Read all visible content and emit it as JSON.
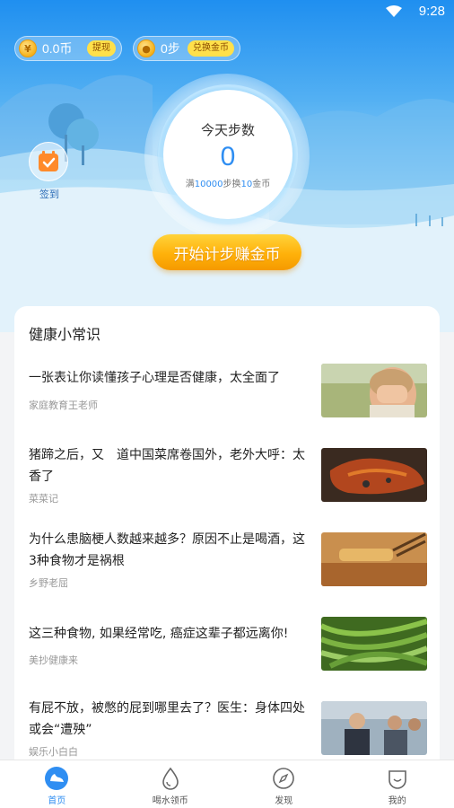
{
  "status_bar": {
    "time": "9:28"
  },
  "wallet": {
    "coin_balance": "0.0币",
    "withdraw_label": "提现",
    "steps_balance": "0步",
    "exchange_label": "兑换金币"
  },
  "step_panel": {
    "title": "今天步数",
    "count": "0",
    "rule_prefix": "满",
    "rule_steps": "10000",
    "rule_mid": "步换",
    "rule_coins": "10",
    "rule_suffix": "金币"
  },
  "checkin": {
    "label": "签到"
  },
  "start_button": {
    "label": "开始计步赚金币"
  },
  "health_section": {
    "title": "健康小常识",
    "articles": [
      {
        "title": "一张表让你读懂孩子心理是否健康，太全面了",
        "source": "家庭教育王老师"
      },
      {
        "title": "猪蹄之后，又　道中国菜席卷国外，老外大呼：太香了",
        "source": "菜菜记"
      },
      {
        "title": "为什么患脑梗人数越来越多？原因不止是喝酒，这3种食物才是祸根",
        "source": "乡野老屈"
      },
      {
        "title": "这三种食物, 如果经常吃, 癌症这辈子都远离你!",
        "source": "美抄健康来"
      },
      {
        "title": "有屁不放，被憋的屁到哪里去了？医生：身体四处或会“遭殃”",
        "source": "娱乐小白白"
      }
    ]
  },
  "bottom_nav": {
    "items": [
      {
        "label": "首页",
        "icon": "shoe-icon",
        "active": true
      },
      {
        "label": "喝水领币",
        "icon": "water-drop-icon",
        "active": false
      },
      {
        "label": "发现",
        "icon": "compass-icon",
        "active": false
      },
      {
        "label": "我的",
        "icon": "smile-face-icon",
        "active": false
      }
    ]
  },
  "colors": {
    "accent": "#2f8ef2",
    "button_orange": "#ffb10a",
    "badge_yellow": "#ffe04a"
  }
}
